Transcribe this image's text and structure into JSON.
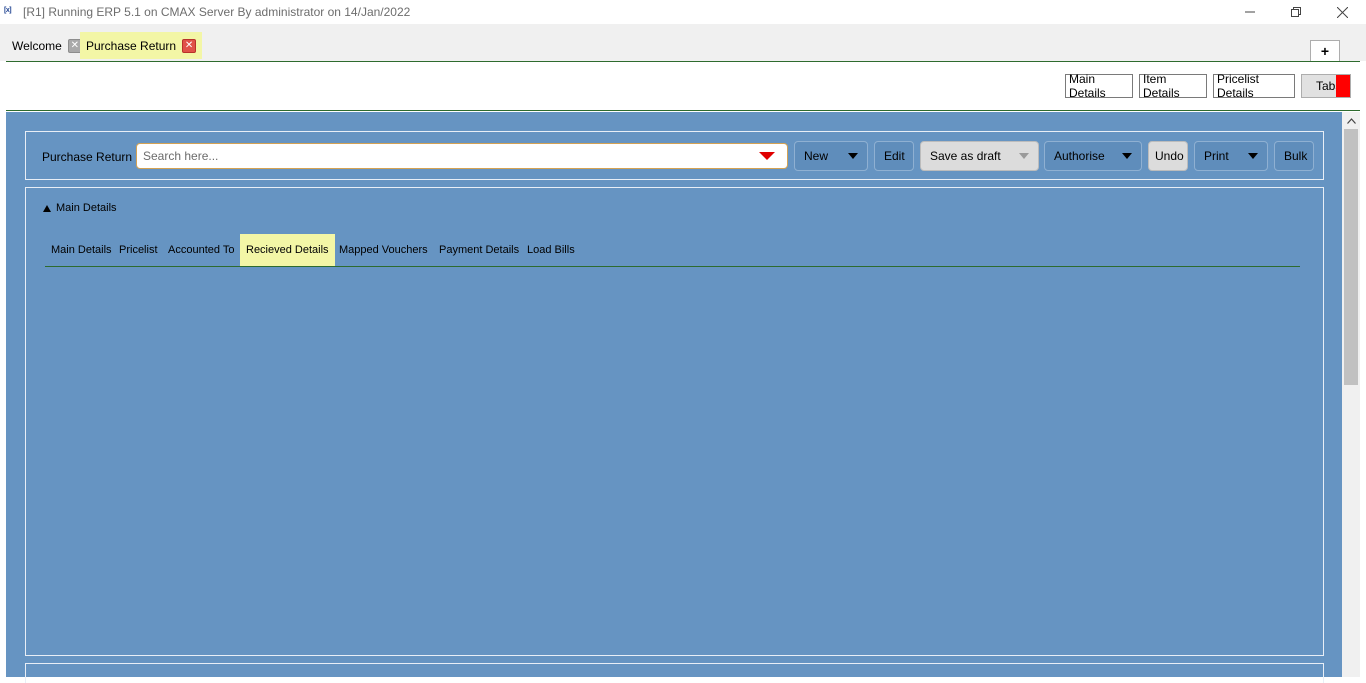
{
  "window": {
    "icon_text": "[x]",
    "title": "[R1] Running ERP 5.1 on CMAX Server By administrator on 14/Jan/2022"
  },
  "doc_tabs": [
    {
      "label": "Welcome",
      "active": false
    },
    {
      "label": "Purchase Return",
      "active": true
    }
  ],
  "add_tab_label": "+",
  "top_buttons": {
    "main_details": "Main Details",
    "item_details": "Item Details",
    "pricelist_details": "Pricelist Details",
    "tabs": "Tabs"
  },
  "toolbar": {
    "label": "Purchase Return",
    "search_placeholder": "Search here...",
    "new": "New",
    "edit": "Edit",
    "save_as_draft": "Save as draft",
    "authorise": "Authorise",
    "undo": "Undo",
    "print": "Print",
    "bulk": "Bulk"
  },
  "details": {
    "section_title": "Main Details",
    "subtabs": [
      {
        "label": "Main Details",
        "active": false
      },
      {
        "label": "Pricelist",
        "active": false
      },
      {
        "label": "Accounted To",
        "active": false
      },
      {
        "label": "Recieved Details",
        "active": true
      },
      {
        "label": "Mapped Vouchers",
        "active": false
      },
      {
        "label": "Payment Details",
        "active": false
      },
      {
        "label": "Load Bills",
        "active": false
      }
    ]
  },
  "colors": {
    "main_bg": "#6694c2",
    "active_tab": "#f3f6a6",
    "accent_red": "#ff0000",
    "divider_green": "#2e6b2e"
  }
}
